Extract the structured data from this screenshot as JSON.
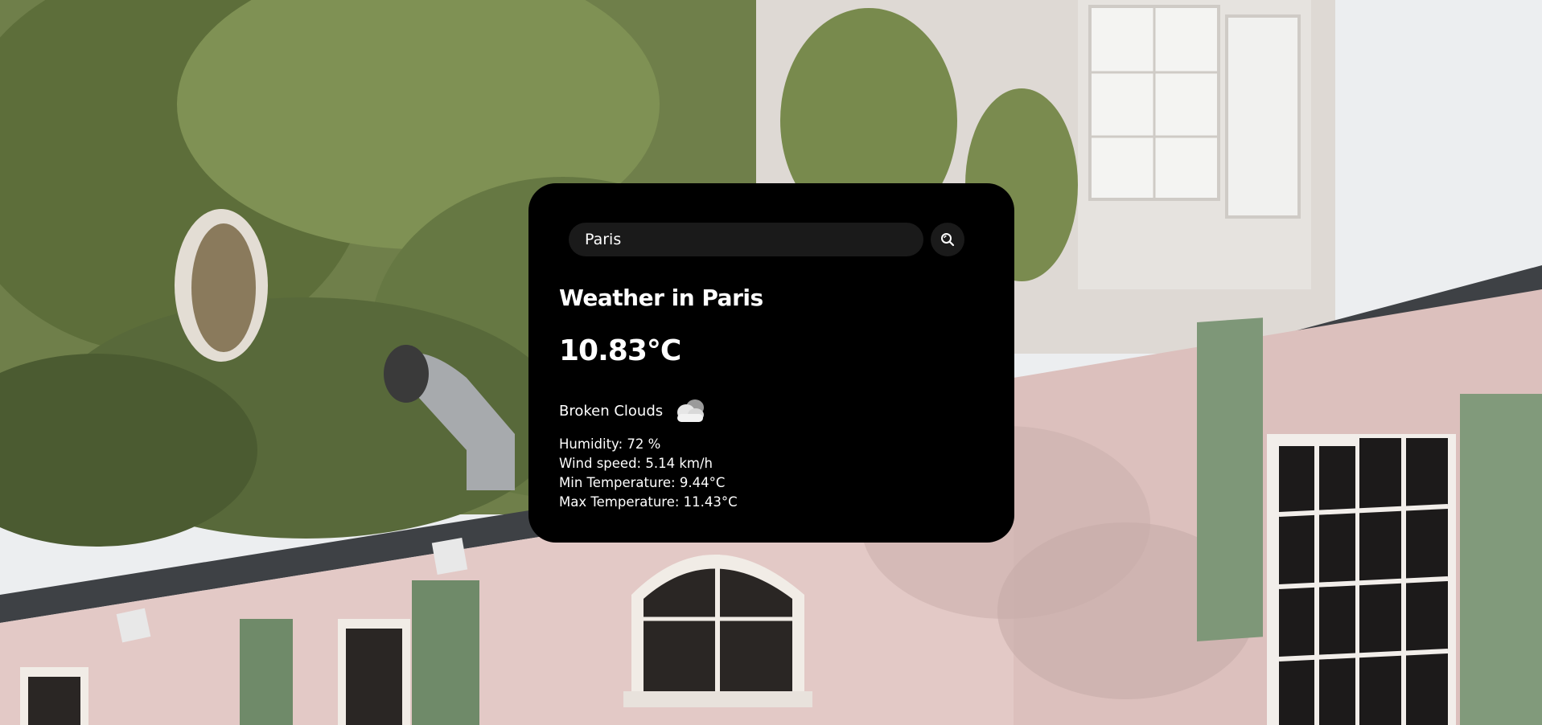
{
  "search": {
    "value": "Paris",
    "button_icon": "search-icon"
  },
  "weather": {
    "title": "Weather in Paris",
    "temperature": "10.83°C",
    "description": "Broken Clouds",
    "condition_icon": "cloud-icon",
    "humidity": "Humidity: 72 %",
    "wind_speed": "Wind speed: 5.14 km/h",
    "min_temperature": "Min Temperature: 9.44°C",
    "max_temperature": "Max Temperature: 11.43°C"
  },
  "colors": {
    "card_background": "#000000",
    "input_background": "#1a1a1a",
    "text": "#ffffff"
  }
}
